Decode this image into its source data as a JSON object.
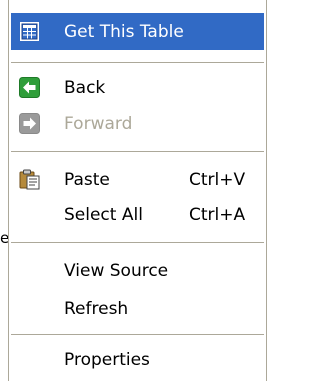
{
  "background": {
    "partial_text": "e"
  },
  "menu": {
    "get_table": "Get This Table",
    "back": "Back",
    "forward": "Forward",
    "paste": "Paste",
    "paste_shortcut": "Ctrl+V",
    "select_all": "Select All",
    "select_all_shortcut": "Ctrl+A",
    "view_source": "View Source",
    "refresh": "Refresh",
    "properties": "Properties"
  },
  "colors": {
    "highlight": "#316ac5",
    "separator": "#aca899",
    "back_icon": "#2f9e3a",
    "forward_icon_disabled": "#9a9a9a"
  },
  "icons": {
    "get_table": "table-icon",
    "back": "back-arrow-icon",
    "forward": "forward-arrow-icon",
    "paste": "clipboard-icon"
  }
}
